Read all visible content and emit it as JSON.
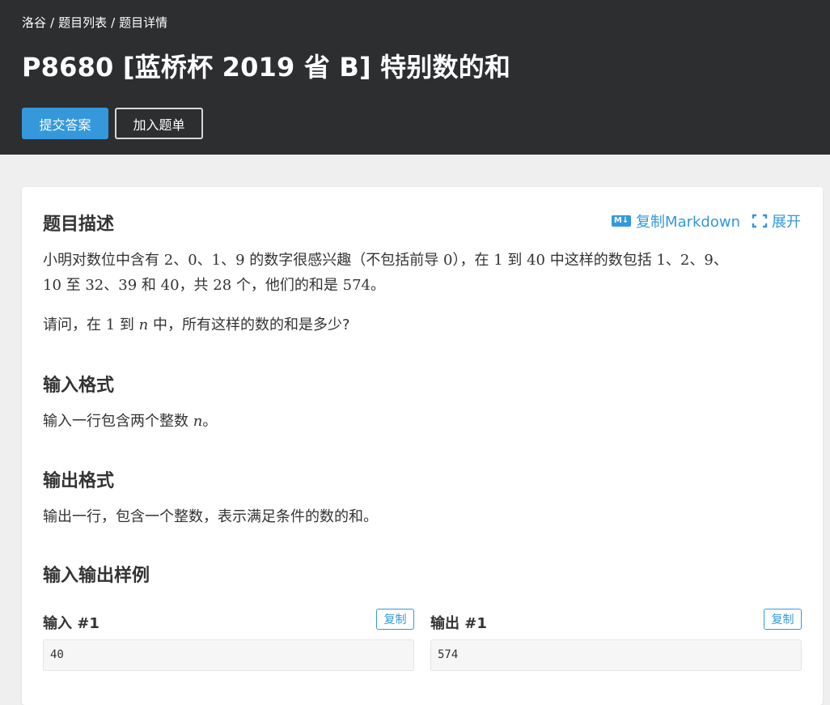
{
  "breadcrumb": [
    "洛谷",
    "题目列表",
    "题目详情"
  ],
  "breadcrumb_sep": "/",
  "title": "P8680 [蓝桥杯 2019 省 B] 特别数的和",
  "buttons": {
    "submit": "提交答案",
    "add": "加入题单"
  },
  "tools": {
    "copy_md": "复制Markdown",
    "expand": "展开",
    "md_icon": "M↓"
  },
  "colors": {
    "accent": "#3498db",
    "header_bg": "#2d2e30",
    "page_bg": "#efefef"
  },
  "sections": {
    "description": {
      "heading": "题目描述",
      "p1_parts": [
        "小明对数位中含有 ",
        "2",
        "、",
        "0",
        "、",
        "1",
        "、",
        "9",
        " 的数字很感兴趣（不包括前导 ",
        "0",
        "），在 ",
        "1",
        " 到 ",
        "40",
        " 中这样的数包括 ",
        "1",
        "、",
        "2",
        "、",
        "9",
        "、"
      ],
      "p1_line2_parts": [
        "10",
        " 至 ",
        "32",
        "、",
        "39",
        " 和 ",
        "40",
        "，共 ",
        "28",
        " 个，他们的和是 ",
        "574",
        "。"
      ],
      "p2_parts": [
        "请问，在 ",
        "1",
        " 到 ",
        "n",
        " 中，所有这样的数的和是多少?"
      ]
    },
    "input_format": {
      "heading": "输入格式",
      "parts": [
        "输入一行包含两个整数 ",
        "n",
        "。"
      ]
    },
    "output_format": {
      "heading": "输出格式",
      "text": "输出一行，包含一个整数，表示满足条件的数的和。"
    },
    "samples": {
      "heading": "输入输出样例",
      "input_label": "输入 #1",
      "output_label": "输出 #1",
      "copy_label": "复制",
      "input_value": "40",
      "output_value": "574"
    }
  }
}
